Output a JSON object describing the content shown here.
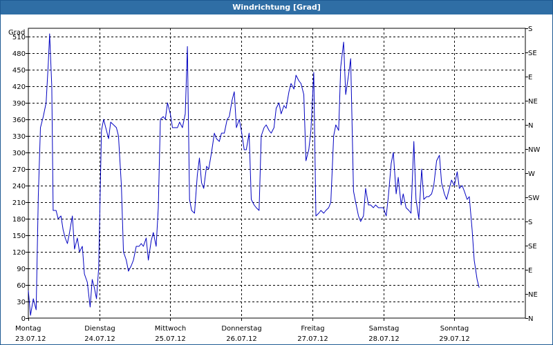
{
  "window": {
    "title": "Windrichtung [Grad]"
  },
  "chart_data": {
    "type": "line",
    "title": "Windrichtung [Grad]",
    "ylabel": "Grad",
    "ylim": [
      0,
      525
    ],
    "xlim": [
      0,
      7
    ],
    "yticks_left": [
      0,
      30,
      60,
      90,
      120,
      150,
      180,
      210,
      240,
      270,
      300,
      330,
      360,
      390,
      420,
      450,
      480,
      510
    ],
    "yticks_right": [
      {
        "v": 0,
        "label": "N"
      },
      {
        "v": 45,
        "label": "NE"
      },
      {
        "v": 90,
        "label": "E"
      },
      {
        "v": 135,
        "label": "SE"
      },
      {
        "v": 180,
        "label": "S"
      },
      {
        "v": 225,
        "label": "SW"
      },
      {
        "v": 270,
        "label": "W"
      },
      {
        "v": 315,
        "label": "NW"
      },
      {
        "v": 360,
        "label": "N"
      },
      {
        "v": 405,
        "label": "NE"
      },
      {
        "v": 450,
        "label": "E"
      },
      {
        "v": 495,
        "label": "SE"
      },
      {
        "v": 540,
        "label": "S"
      }
    ],
    "x_categories": [
      {
        "day": "Montag",
        "date": "23.07.12"
      },
      {
        "day": "Dienstag",
        "date": "24.07.12"
      },
      {
        "day": "Mittwoch",
        "date": "25.07.12"
      },
      {
        "day": "Donnerstag",
        "date": "26.07.12"
      },
      {
        "day": "Freitag",
        "date": "27.07.12"
      },
      {
        "day": "Samstag",
        "date": "28.07.12"
      },
      {
        "day": "Sonntag",
        "date": "29.07.12"
      }
    ],
    "grid": true,
    "colors": {
      "line": "#0000c0",
      "grid": "#000000",
      "title_bg": "#2f6ea5"
    },
    "series": [
      {
        "points": [
          [
            0.0,
            50
          ],
          [
            0.03,
            5
          ],
          [
            0.07,
            35
          ],
          [
            0.11,
            15
          ],
          [
            0.14,
            220
          ],
          [
            0.17,
            345
          ],
          [
            0.21,
            365
          ],
          [
            0.25,
            390
          ],
          [
            0.28,
            460
          ],
          [
            0.3,
            515
          ],
          [
            0.33,
            420
          ],
          [
            0.35,
            195
          ],
          [
            0.39,
            195
          ],
          [
            0.42,
            180
          ],
          [
            0.46,
            185
          ],
          [
            0.49,
            160
          ],
          [
            0.52,
            145
          ],
          [
            0.55,
            135
          ],
          [
            0.58,
            155
          ],
          [
            0.62,
            185
          ],
          [
            0.65,
            125
          ],
          [
            0.69,
            145
          ],
          [
            0.72,
            120
          ],
          [
            0.76,
            130
          ],
          [
            0.79,
            80
          ],
          [
            0.83,
            65
          ],
          [
            0.87,
            20
          ],
          [
            0.9,
            70
          ],
          [
            0.93,
            55
          ],
          [
            0.96,
            35
          ],
          [
            0.99,
            90
          ],
          [
            1.03,
            340
          ],
          [
            1.06,
            360
          ],
          [
            1.1,
            340
          ],
          [
            1.13,
            325
          ],
          [
            1.16,
            355
          ],
          [
            1.2,
            350
          ],
          [
            1.24,
            345
          ],
          [
            1.27,
            330
          ],
          [
            1.31,
            240
          ],
          [
            1.34,
            120
          ],
          [
            1.38,
            105
          ],
          [
            1.41,
            85
          ],
          [
            1.45,
            95
          ],
          [
            1.48,
            105
          ],
          [
            1.52,
            130
          ],
          [
            1.56,
            130
          ],
          [
            1.59,
            135
          ],
          [
            1.62,
            130
          ],
          [
            1.66,
            145
          ],
          [
            1.69,
            105
          ],
          [
            1.73,
            140
          ],
          [
            1.76,
            155
          ],
          [
            1.8,
            130
          ],
          [
            1.83,
            200
          ],
          [
            1.86,
            360
          ],
          [
            1.9,
            365
          ],
          [
            1.93,
            360
          ],
          [
            1.96,
            390
          ],
          [
            2.0,
            370
          ],
          [
            2.03,
            345
          ],
          [
            2.06,
            345
          ],
          [
            2.1,
            345
          ],
          [
            2.13,
            355
          ],
          [
            2.17,
            345
          ],
          [
            2.21,
            370
          ],
          [
            2.24,
            492
          ],
          [
            2.27,
            215
          ],
          [
            2.3,
            195
          ],
          [
            2.34,
            190
          ],
          [
            2.38,
            260
          ],
          [
            2.41,
            290
          ],
          [
            2.44,
            245
          ],
          [
            2.47,
            235
          ],
          [
            2.51,
            275
          ],
          [
            2.54,
            270
          ],
          [
            2.58,
            300
          ],
          [
            2.62,
            335
          ],
          [
            2.65,
            325
          ],
          [
            2.69,
            320
          ],
          [
            2.72,
            335
          ],
          [
            2.76,
            335
          ],
          [
            2.8,
            360
          ],
          [
            2.83,
            365
          ],
          [
            2.87,
            395
          ],
          [
            2.9,
            410
          ],
          [
            2.93,
            345
          ],
          [
            2.97,
            360
          ],
          [
            3.0,
            340
          ],
          [
            3.04,
            305
          ],
          [
            3.07,
            305
          ],
          [
            3.11,
            335
          ],
          [
            3.14,
            215
          ],
          [
            3.18,
            205
          ],
          [
            3.21,
            200
          ],
          [
            3.25,
            195
          ],
          [
            3.28,
            330
          ],
          [
            3.32,
            345
          ],
          [
            3.35,
            350
          ],
          [
            3.39,
            340
          ],
          [
            3.42,
            335
          ],
          [
            3.46,
            345
          ],
          [
            3.49,
            380
          ],
          [
            3.53,
            390
          ],
          [
            3.56,
            370
          ],
          [
            3.6,
            385
          ],
          [
            3.63,
            380
          ],
          [
            3.67,
            410
          ],
          [
            3.7,
            425
          ],
          [
            3.74,
            415
          ],
          [
            3.77,
            440
          ],
          [
            3.81,
            430
          ],
          [
            3.84,
            425
          ],
          [
            3.88,
            405
          ],
          [
            3.91,
            285
          ],
          [
            3.95,
            305
          ],
          [
            3.98,
            340
          ],
          [
            4.02,
            445
          ],
          [
            4.05,
            185
          ],
          [
            4.09,
            190
          ],
          [
            4.12,
            195
          ],
          [
            4.16,
            190
          ],
          [
            4.19,
            195
          ],
          [
            4.23,
            200
          ],
          [
            4.26,
            210
          ],
          [
            4.3,
            330
          ],
          [
            4.33,
            350
          ],
          [
            4.37,
            340
          ],
          [
            4.4,
            455
          ],
          [
            4.44,
            500
          ],
          [
            4.47,
            405
          ],
          [
            4.51,
            440
          ],
          [
            4.54,
            470
          ],
          [
            4.58,
            230
          ],
          [
            4.61,
            210
          ],
          [
            4.65,
            185
          ],
          [
            4.68,
            175
          ],
          [
            4.72,
            185
          ],
          [
            4.75,
            235
          ],
          [
            4.79,
            205
          ],
          [
            4.82,
            205
          ],
          [
            4.86,
            200
          ],
          [
            4.89,
            205
          ],
          [
            4.93,
            200
          ],
          [
            5.0,
            200
          ],
          [
            5.04,
            185
          ],
          [
            5.07,
            220
          ],
          [
            5.11,
            280
          ],
          [
            5.14,
            300
          ],
          [
            5.18,
            225
          ],
          [
            5.21,
            255
          ],
          [
            5.25,
            205
          ],
          [
            5.28,
            225
          ],
          [
            5.32,
            200
          ],
          [
            5.36,
            195
          ],
          [
            5.39,
            190
          ],
          [
            5.43,
            320
          ],
          [
            5.46,
            215
          ],
          [
            5.5,
            180
          ],
          [
            5.54,
            270
          ],
          [
            5.57,
            215
          ],
          [
            5.61,
            220
          ],
          [
            5.64,
            220
          ],
          [
            5.68,
            225
          ],
          [
            5.71,
            240
          ],
          [
            5.75,
            285
          ],
          [
            5.79,
            295
          ],
          [
            5.82,
            245
          ],
          [
            5.86,
            225
          ],
          [
            5.89,
            215
          ],
          [
            5.93,
            235
          ],
          [
            5.96,
            250
          ],
          [
            6.0,
            240
          ],
          [
            6.04,
            265
          ],
          [
            6.07,
            235
          ],
          [
            6.11,
            240
          ],
          [
            6.14,
            230
          ],
          [
            6.18,
            215
          ],
          [
            6.21,
            220
          ],
          [
            6.25,
            160
          ],
          [
            6.28,
            105
          ],
          [
            6.32,
            70
          ],
          [
            6.35,
            55
          ]
        ]
      }
    ]
  }
}
